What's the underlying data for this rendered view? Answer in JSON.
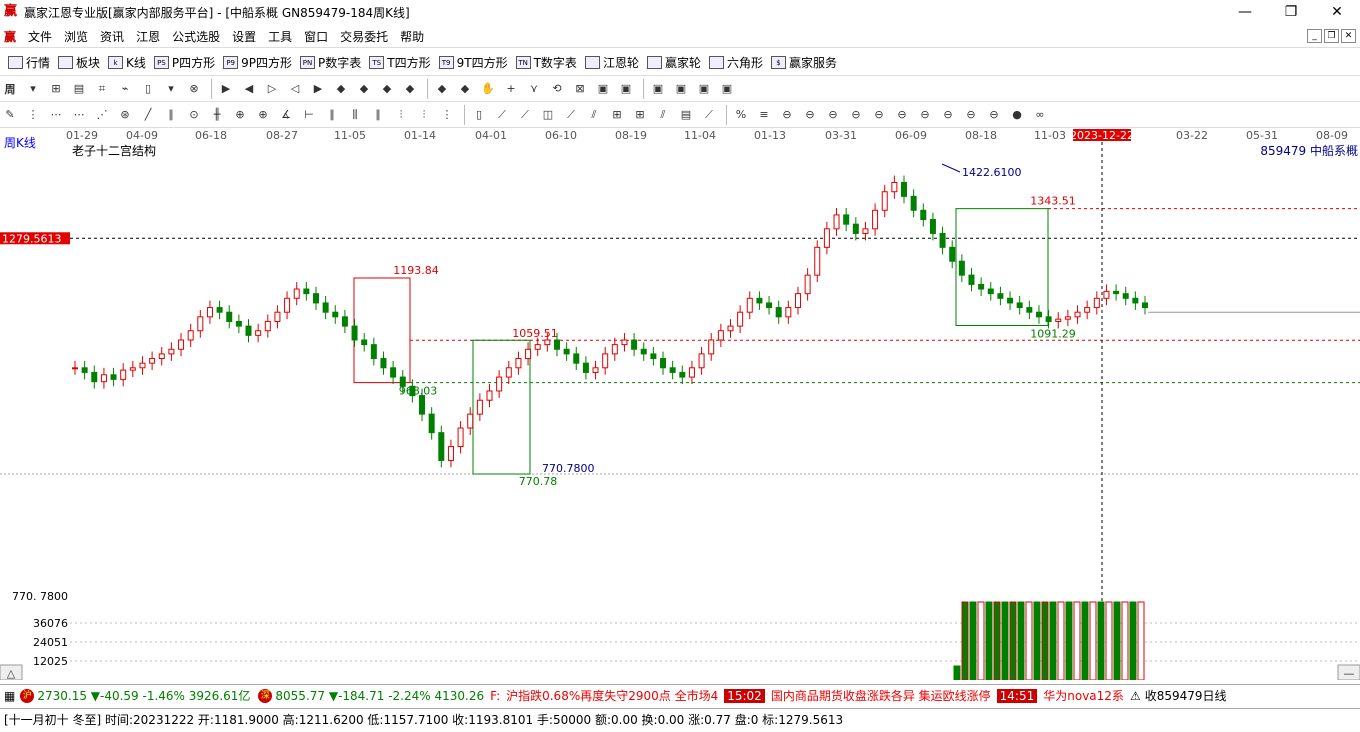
{
  "window": {
    "title": "赢家江恩专业版[赢家内部服务平台] - [中船系概  GN859479-184周K线]",
    "logo": "赢"
  },
  "menu": {
    "items": [
      "文件",
      "浏览",
      "资讯",
      "江恩",
      "公式选股",
      "设置",
      "工具",
      "窗口",
      "交易委托",
      "帮助"
    ]
  },
  "toolbar1": {
    "items": [
      {
        "label": "行情",
        "icon": "grid"
      },
      {
        "label": "板块",
        "icon": "grid"
      },
      {
        "label": "K线",
        "icon": "k"
      },
      {
        "label": "P四方形",
        "icon": "PS"
      },
      {
        "label": "9P四方形",
        "icon": "P9"
      },
      {
        "label": "P数字表",
        "icon": "PN"
      },
      {
        "label": "T四方形",
        "icon": "TS"
      },
      {
        "label": "9T四方形",
        "icon": "T9"
      },
      {
        "label": "T数字表",
        "icon": "TN"
      },
      {
        "label": "江恩轮",
        "icon": "wheel"
      },
      {
        "label": "赢家轮",
        "icon": "wheel"
      },
      {
        "label": "六角形",
        "icon": "hex"
      },
      {
        "label": "赢家服务",
        "icon": "$"
      }
    ]
  },
  "toolbar2": {
    "period_label": "周"
  },
  "chart": {
    "period": "周K线",
    "indicator": "老子十二宫结构",
    "stock": "859479  中船系概",
    "current_price_tag": "1279.5613",
    "cursor_date": "2023-12-22",
    "dates": [
      "01-29",
      "04-09",
      "06-18",
      "08-27",
      "11-05",
      "01-14",
      "04-01",
      "06-10",
      "08-19",
      "11-04",
      "01-13",
      "03-31",
      "06-09",
      "08-18",
      "11-03",
      "2023-12-22",
      "03-22",
      "05-31",
      "08-09"
    ],
    "annotations": {
      "high_peak": "1422.6100",
      "box_top_red": "1343.51",
      "box_bottom_green": "1091.29",
      "box2_top": "1193.84",
      "box2_bottom": "968.03",
      "box3_top": "1059.51",
      "low_label": "770.7800",
      "low_green": "770.78"
    },
    "y_labels": {
      "low": "770. 7800",
      "vol1": "36076",
      "vol2": "24051",
      "vol3": "12025"
    }
  },
  "chart_data": {
    "type": "candlestick",
    "title": "老子十二宫结构",
    "levels": {
      "peak": 1422.61,
      "box1_top": 1343.51,
      "box1_bottom": 1091.29,
      "box2_top": 1193.84,
      "box2_bottom": 968.03,
      "box3_top": 1059.51,
      "low": 770.78,
      "current": 1279.5613
    }
  },
  "status1": {
    "idx1_name": "沪",
    "idx1": "2730.15 ▼-40.59 -1.46% 3926.61亿",
    "idx2_name": "深",
    "idx2": "8055.77 ▼-184.71 -2.24% 4130.26",
    "news1_prefix": "F:",
    "news1": "沪指跌0.68%再度失守2900点 全市场4",
    "time2": "15:02",
    "news2": "国内商品期货收盘涨跌各异 集运欧线涨停",
    "time3": "14:51",
    "news3": "华为nova12系",
    "code": "收859479日线"
  },
  "status2": {
    "text": "[十一月初十 冬至] 时间:20231222 开:1181.9000 高:1211.6200 低:1157.7100 收:1193.8101 手:50000 额:0.00 换:0.00 涨:0.77 盘:0 标:1279.5613"
  },
  "colors": {
    "up": "#e00000",
    "down": "#008000",
    "grid": "#008000",
    "accent": "#c00000"
  }
}
